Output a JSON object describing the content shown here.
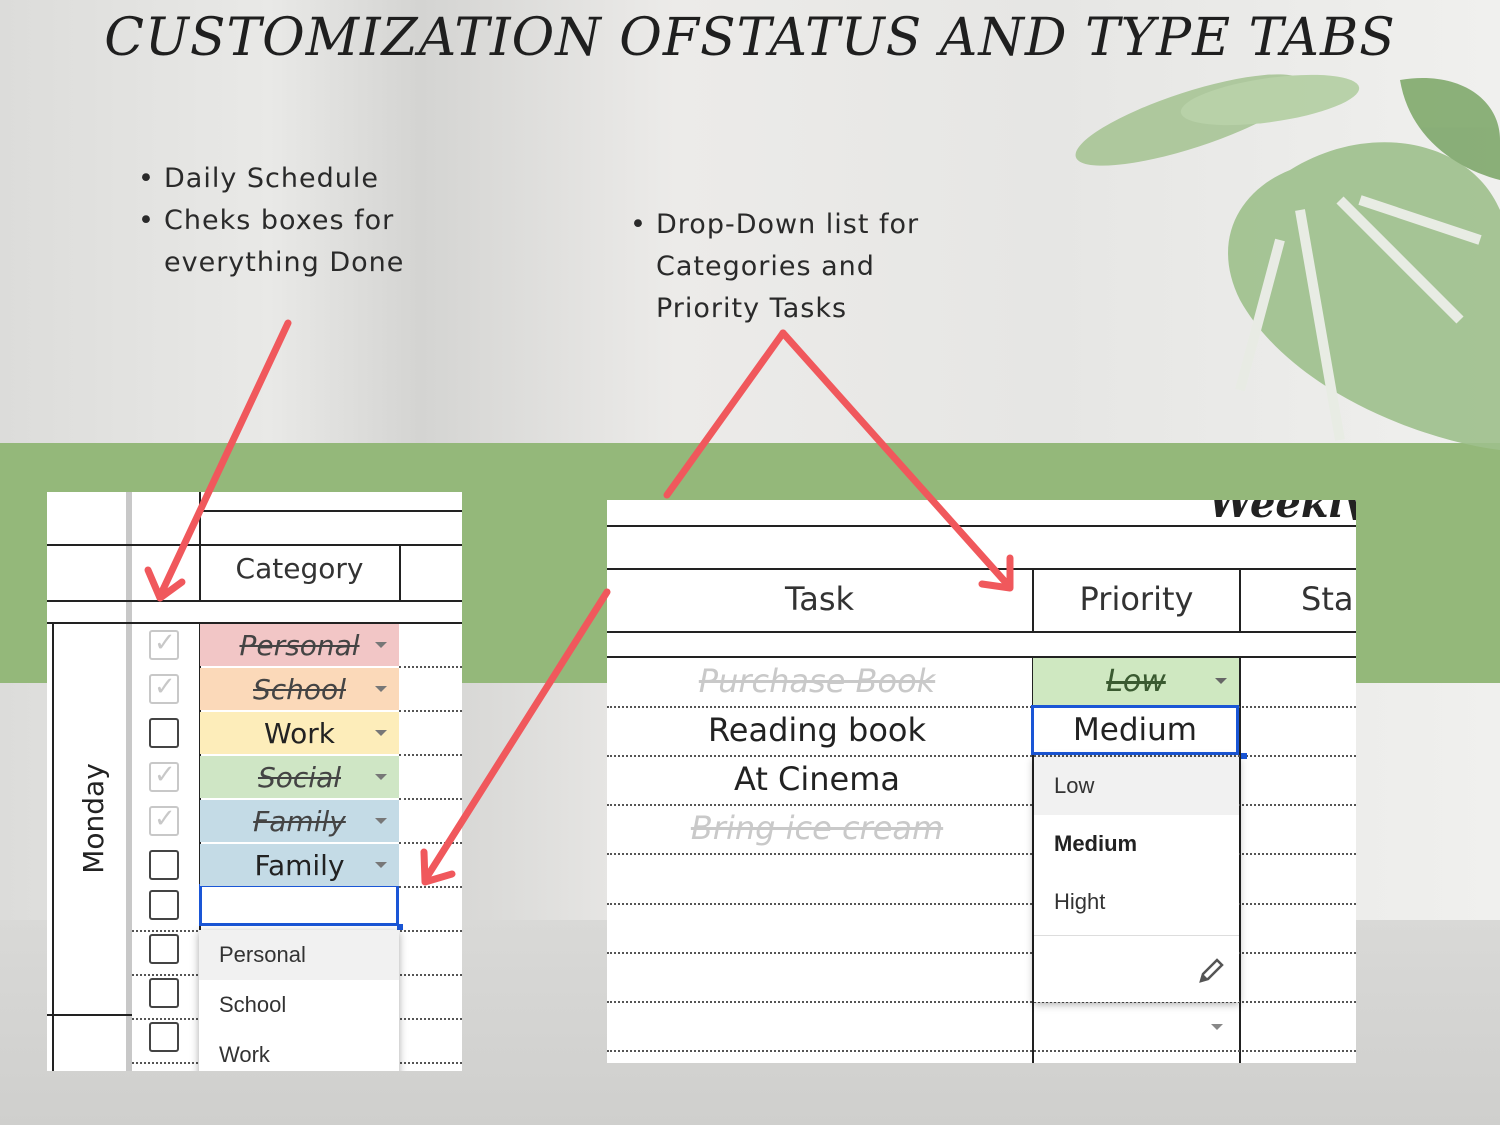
{
  "title": "CUSTOMIZATION OFSTATUS AND TYPE TABS",
  "bullets_left": [
    "Daily Schedule",
    "Cheks boxes for everything Done"
  ],
  "bullets_right": [
    "Drop-Down list for Categories and Priority Tasks"
  ],
  "left_sheet": {
    "header": "Category",
    "day_label": "Monday",
    "rows": [
      {
        "label": "Personal",
        "done": true,
        "color": "#f2c6c6"
      },
      {
        "label": "School",
        "done": true,
        "color": "#fbd9b9"
      },
      {
        "label": "Work",
        "done": false,
        "color": "#fdedba"
      },
      {
        "label": "Social",
        "done": true,
        "color": "#cfe6c5"
      },
      {
        "label": "Family",
        "done": true,
        "color": "#c4dbe6"
      },
      {
        "label": "Family",
        "done": false,
        "color": "#c4dbe6"
      }
    ],
    "dropdown_options": [
      "Personal",
      "School",
      "Work"
    ]
  },
  "right_sheet": {
    "header_partial": "Weekly",
    "columns": [
      "Task",
      "Priority",
      "Sta"
    ],
    "tasks": [
      {
        "label": "Purchase Book",
        "done": true
      },
      {
        "label": "Reading book",
        "done": false
      },
      {
        "label": "At Cinema",
        "done": false
      },
      {
        "label": "Bring ice cream",
        "done": true
      }
    ],
    "priority_selected": "Low",
    "priority_editing": "Medium",
    "dropdown_options": [
      "Low",
      "Medium",
      "Hight"
    ],
    "colors": {
      "low": "#cfe8c1",
      "accent_blue": "#1a56d6",
      "arrow": "#f0585c",
      "band": "#94b87a"
    }
  }
}
